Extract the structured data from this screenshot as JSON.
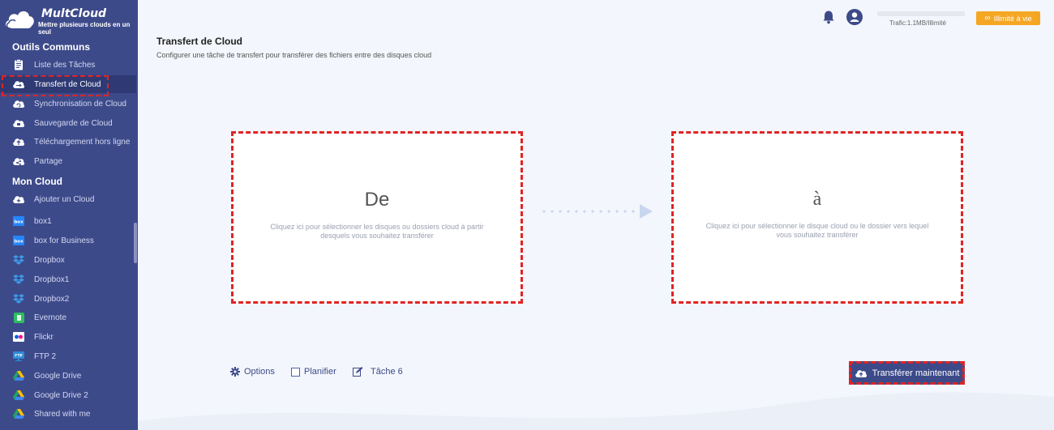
{
  "app": {
    "brand": "MultCloud",
    "tagline": "Mettre plusieurs clouds en un seul"
  },
  "sidebar": {
    "section_tools": "Outils Communs",
    "tools": [
      {
        "label": "Liste des Tâches",
        "icon": "task-list-icon"
      },
      {
        "label": "Transfert de Cloud",
        "icon": "cloud-transfer-icon",
        "active": true
      },
      {
        "label": "Synchronisation de Cloud",
        "icon": "cloud-sync-icon"
      },
      {
        "label": "Sauvegarde de Cloud",
        "icon": "cloud-backup-icon"
      },
      {
        "label": "Téléchargement hors ligne",
        "icon": "cloud-upload-icon"
      },
      {
        "label": "Partage",
        "icon": "share-icon"
      }
    ],
    "section_cloud": "Mon Cloud",
    "clouds": [
      {
        "label": "Ajouter un Cloud",
        "icon": "add-cloud-icon"
      },
      {
        "label": "box1",
        "icon": "box-icon"
      },
      {
        "label": "box for Business",
        "icon": "box-icon"
      },
      {
        "label": "Dropbox",
        "icon": "dropbox-icon"
      },
      {
        "label": "Dropbox1",
        "icon": "dropbox-icon"
      },
      {
        "label": "Dropbox2",
        "icon": "dropbox-icon"
      },
      {
        "label": "Evernote",
        "icon": "evernote-icon"
      },
      {
        "label": "Flickr",
        "icon": "flickr-icon"
      },
      {
        "label": "FTP 2",
        "icon": "ftp-icon"
      },
      {
        "label": "Google Drive",
        "icon": "google-drive-icon"
      },
      {
        "label": "Google Drive 2",
        "icon": "google-drive-icon"
      },
      {
        "label": "Shared with me",
        "icon": "google-drive-icon"
      }
    ]
  },
  "topbar": {
    "traffic": "Trafic:1.1MB/Illimité",
    "unlimited": "Illimité à vie"
  },
  "main": {
    "title": "Transfert de Cloud",
    "subtitle": "Configurer une tâche de transfert pour transférer des fichiers entre des disques cloud",
    "from_title": "De",
    "from_hint": "Cliquez ici pour sélectionner les disques ou dossiers cloud à partir desquels vous souhaitez transférer",
    "to_title": "à",
    "to_hint": "Cliquez ici pour sélectionner le disque cloud ou le dossier vers lequel vous souhaitez transférer"
  },
  "toolbar": {
    "options": "Options",
    "schedule": "Planifier",
    "task": "Tâche 6",
    "transfer": "Transférer maintenant"
  },
  "colors": {
    "sidebar": "#3d4a8a",
    "accent": "#f5a623",
    "highlight": "#e02424"
  }
}
